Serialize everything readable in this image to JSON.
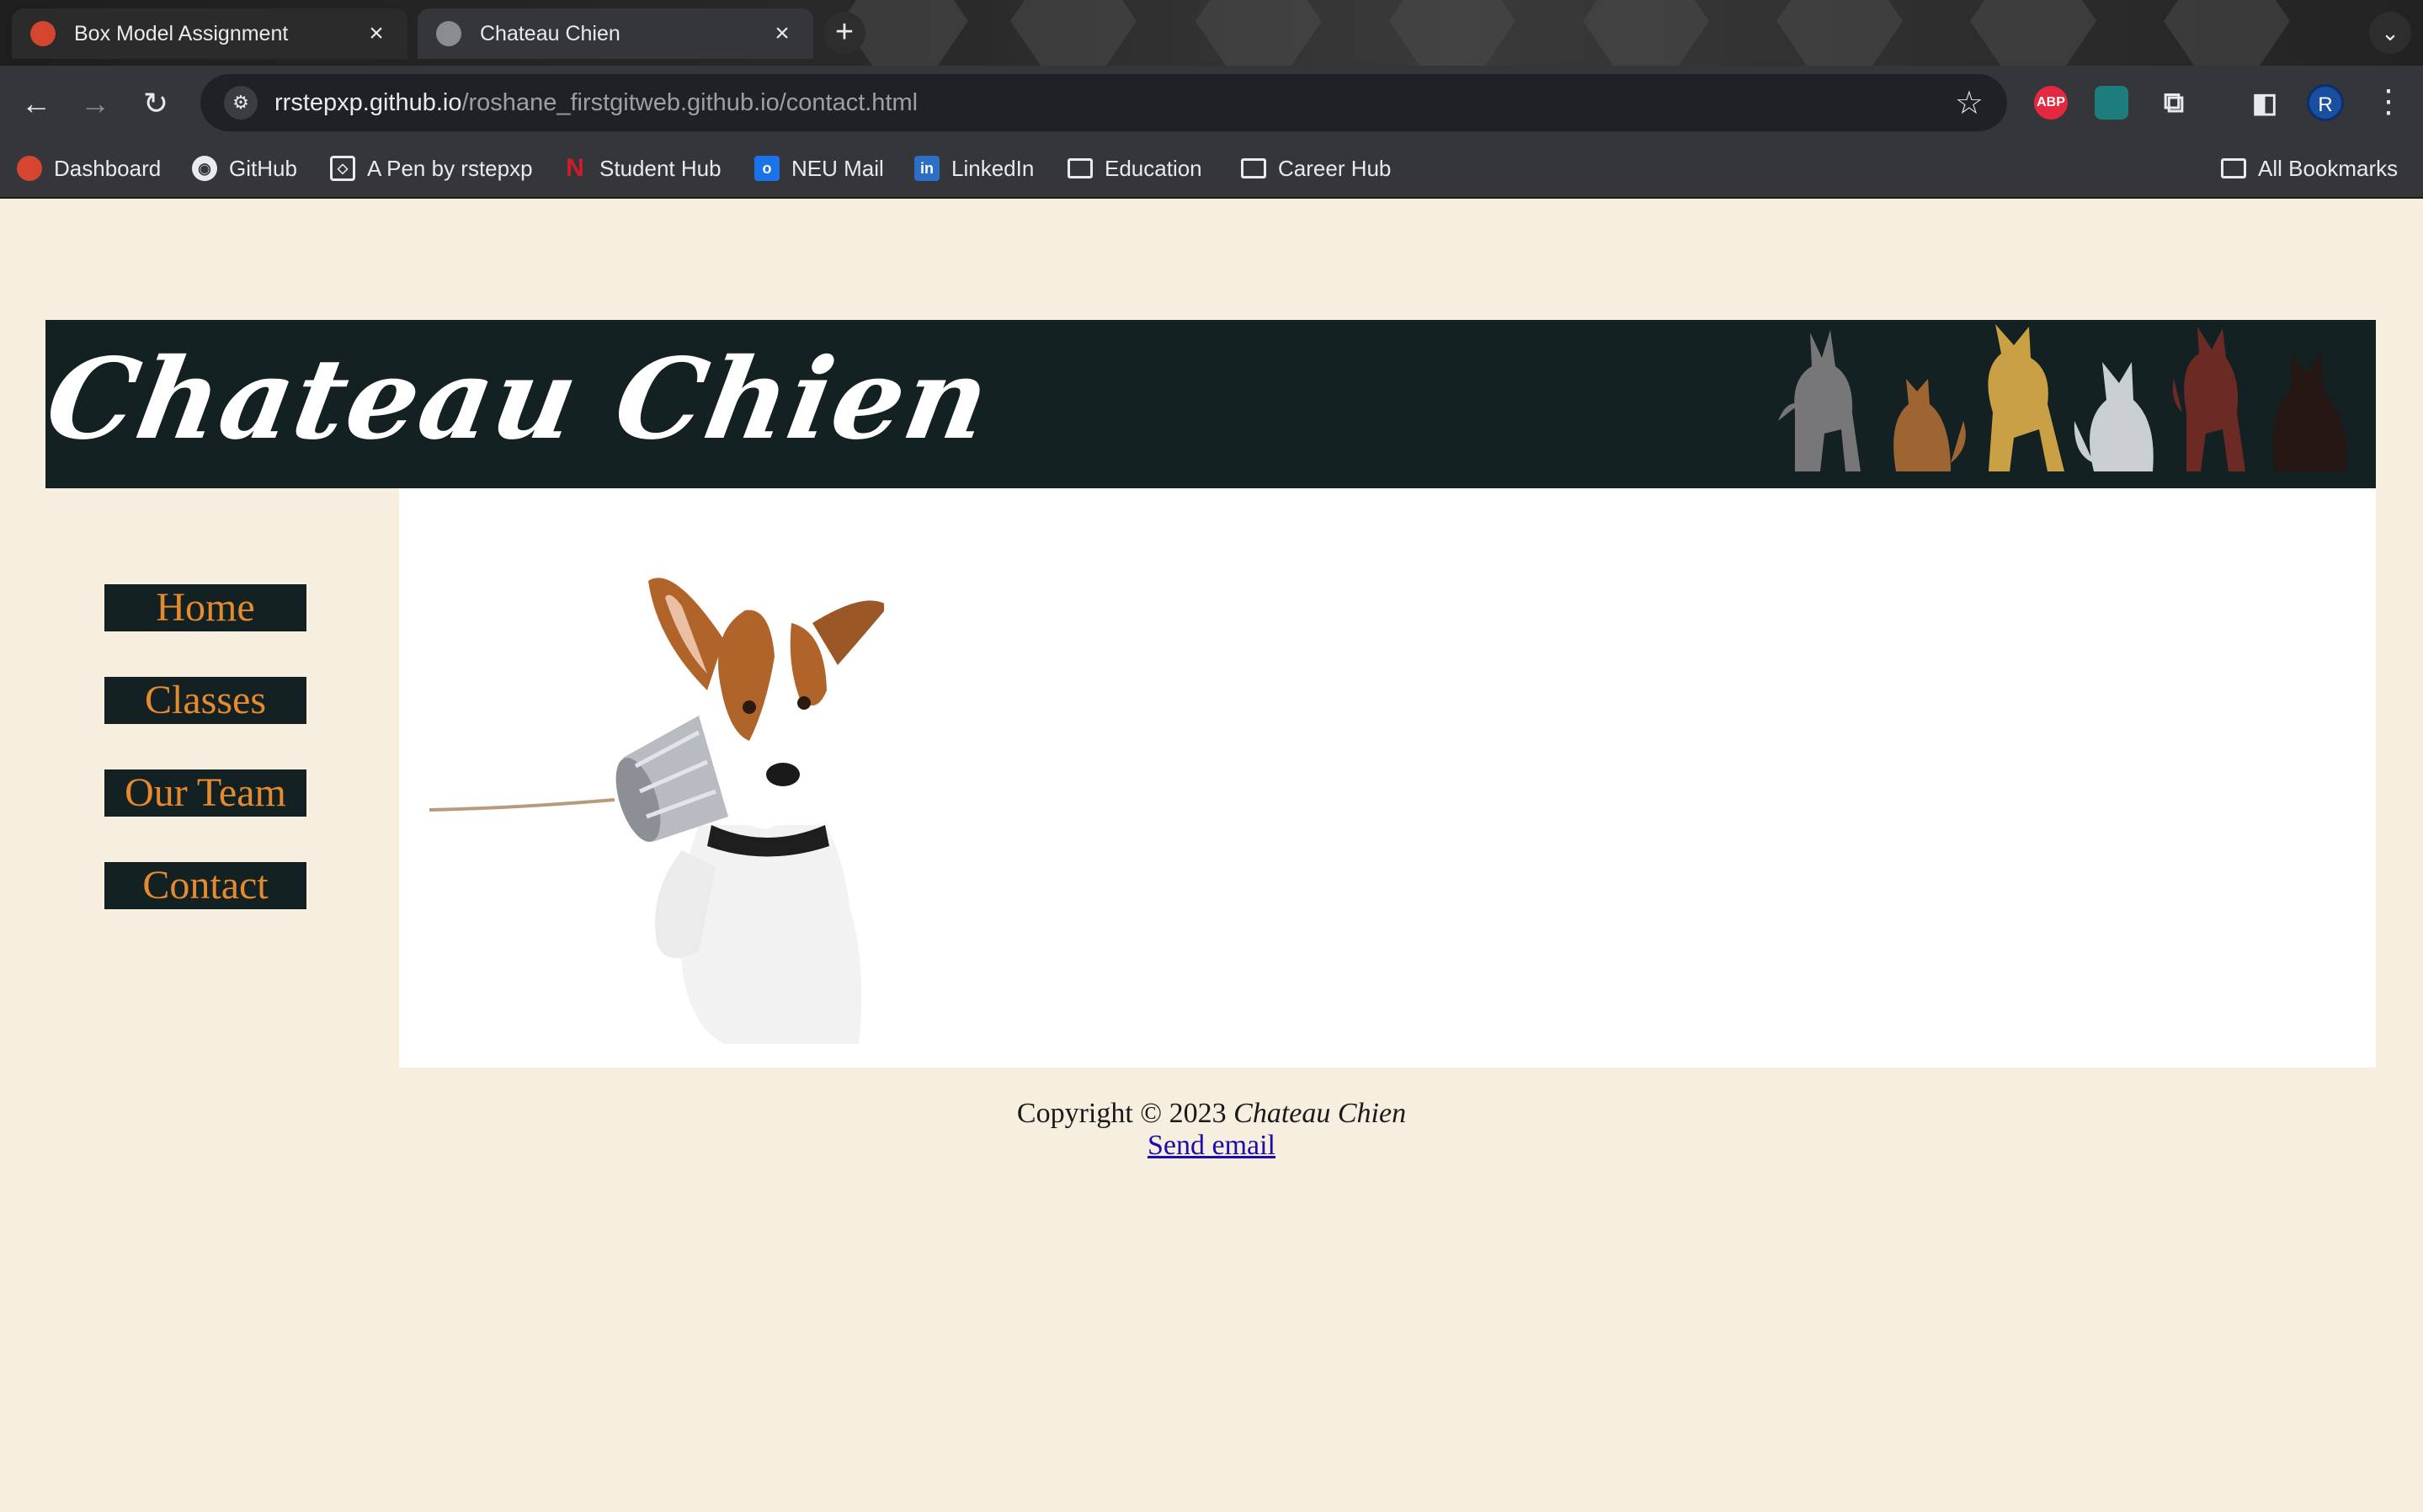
{
  "browser": {
    "tabs": [
      {
        "title": "Box Model Assignment",
        "active": false
      },
      {
        "title": "Chateau Chien",
        "active": true
      }
    ],
    "new_tab_label": "+",
    "address": {
      "host": "rrstepxp.github.io",
      "path": "/roshane_firstgitweb.github.io/contact.html"
    },
    "profile_initial": "R",
    "extensions": [
      {
        "name": "adblock-plus",
        "label": "ABP",
        "color": "#e3283f"
      },
      {
        "name": "amazon-assistant",
        "label": "",
        "color": "#1d7d7d"
      }
    ],
    "bookmarks": [
      {
        "label": "Dashboard",
        "icon": "canvas-icon"
      },
      {
        "label": "GitHub",
        "icon": "github-icon"
      },
      {
        "label": "A Pen by rstepxp",
        "icon": "codepen-icon"
      },
      {
        "label": "Student Hub",
        "icon": "northeastern-icon"
      },
      {
        "label": "NEU Mail",
        "icon": "outlook-icon"
      },
      {
        "label": "LinkedIn",
        "icon": "linkedin-icon"
      },
      {
        "label": "Education",
        "icon": "folder-icon"
      },
      {
        "label": "Career Hub",
        "icon": "folder-icon"
      }
    ],
    "all_bookmarks_label": "All Bookmarks"
  },
  "site": {
    "brand": "Chateau Chien",
    "nav": [
      {
        "label": "Home"
      },
      {
        "label": "Classes"
      },
      {
        "label": "Our Team"
      },
      {
        "label": "Contact"
      }
    ],
    "footer": {
      "copyright_prefix": "Copyright © 2023",
      "copyright_brand": "Chateau Chien",
      "email_link": "Send email"
    },
    "colors": {
      "page_bg": "#f6eedf",
      "header_bg": "#132123",
      "nav_text": "#e68a2e",
      "content_bg": "#ffffff"
    }
  }
}
